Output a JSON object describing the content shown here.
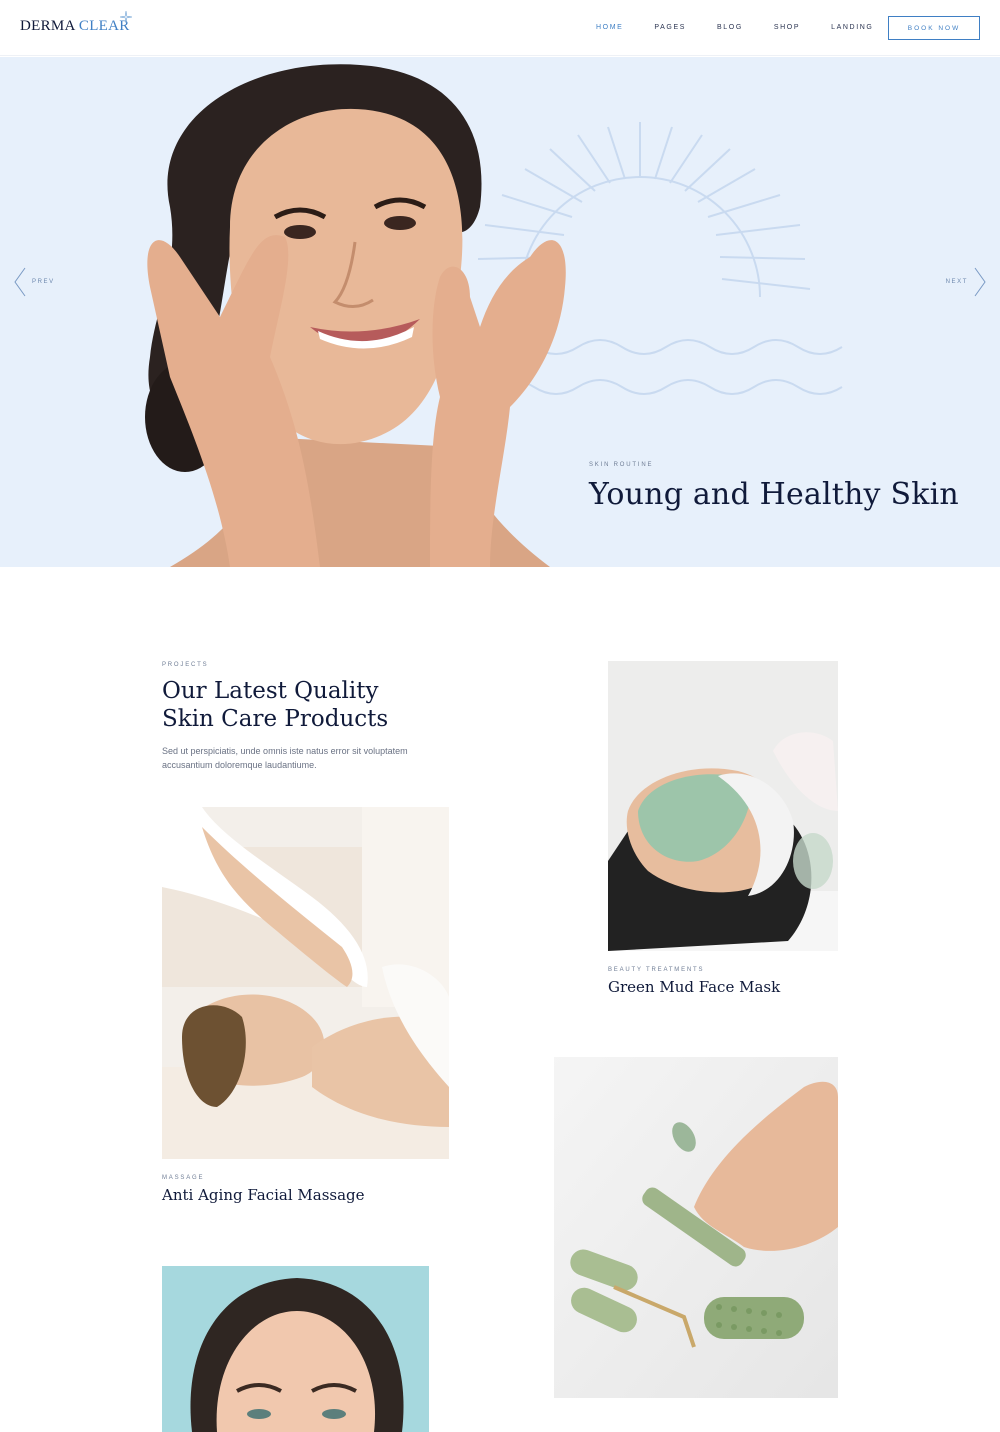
{
  "brand": {
    "name_part1": "DERMA",
    "name_part2": "CLEAR"
  },
  "nav": {
    "items": [
      {
        "label": "HOME",
        "active": true
      },
      {
        "label": "PAGES",
        "active": false
      },
      {
        "label": "BLOG",
        "active": false
      },
      {
        "label": "SHOP",
        "active": false
      },
      {
        "label": "LANDING",
        "active": false
      }
    ],
    "cta": "BOOK NOW"
  },
  "hero": {
    "eyebrow": "SKIN ROUTINE",
    "title": "Young and Healthy Skin",
    "prev": "PREV",
    "next": "NEXT"
  },
  "projects": {
    "eyebrow": "PROJECTS",
    "title_line1": "Our Latest Quality",
    "title_line2": "Skin Care Products",
    "description": "Sed ut perspiciatis, unde omnis iste natus error sit voluptatem accusantium doloremque laudantiume.",
    "cards": [
      {
        "category": "BEAUTY TREATMENTS",
        "title": "Green Mud Face Mask"
      },
      {
        "category": "MASSAGE",
        "title": "Anti Aging Facial Massage"
      }
    ]
  },
  "colors": {
    "accent": "#3f7fc4",
    "navy": "#101a3a",
    "hero_bg": "#e7f0fb"
  }
}
